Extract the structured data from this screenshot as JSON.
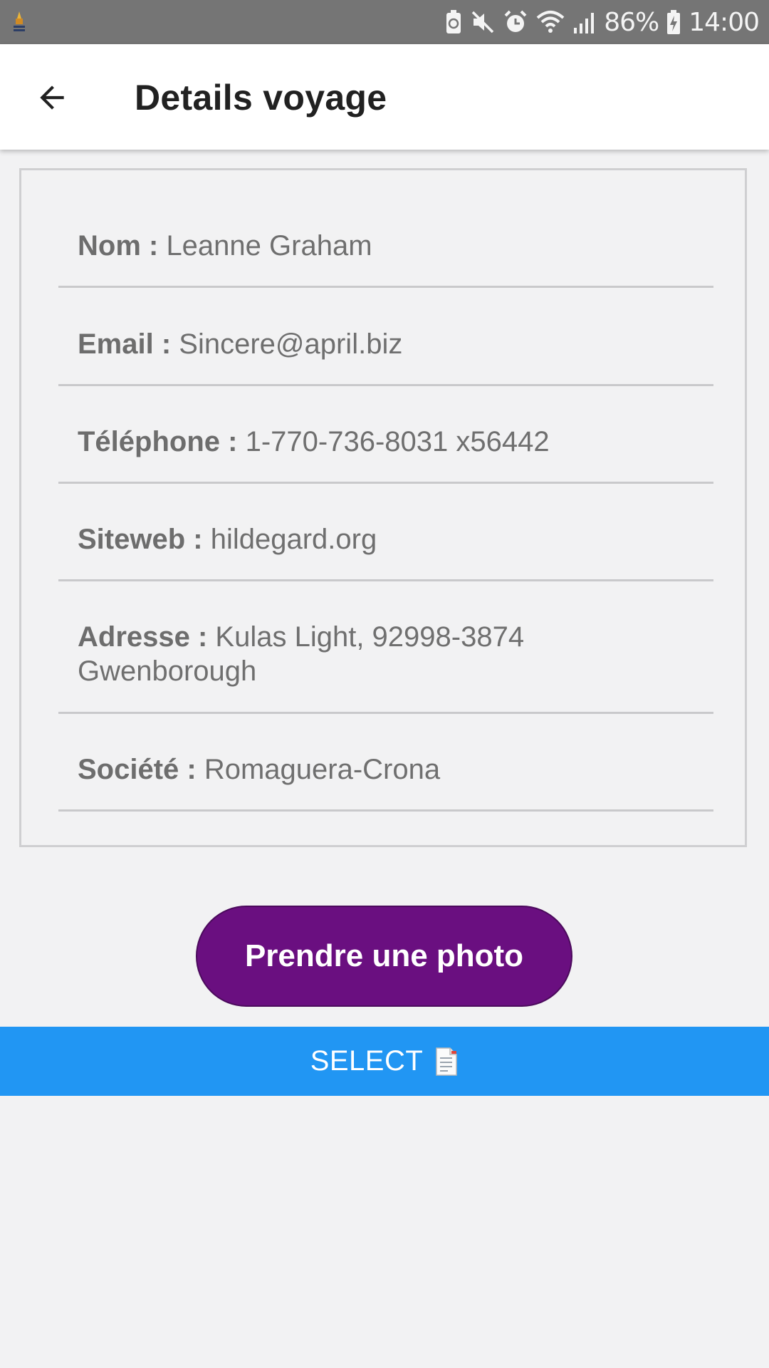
{
  "status_bar": {
    "battery": "86%",
    "time": "14:00",
    "icons": [
      "app-notification-icon",
      "battery-saver-icon",
      "mute-icon",
      "alarm-icon",
      "wifi-icon",
      "signal-icon",
      "battery-charging-icon"
    ]
  },
  "app_bar": {
    "back_icon": "arrow-back-icon",
    "title": "Details voyage"
  },
  "details": {
    "nom": {
      "label": "Nom : ",
      "value": "Leanne Graham"
    },
    "email": {
      "label": "Email : ",
      "value": "Sincere@april.biz"
    },
    "telephone": {
      "label": "Téléphone : ",
      "value": "1-770-736-8031 x56442"
    },
    "siteweb": {
      "label": "Siteweb : ",
      "value": "hildegard.org"
    },
    "adresse": {
      "label": "Adresse : ",
      "value": "Kulas Light, 92998-3874",
      "value_line2": "Gwenborough"
    },
    "societe": {
      "label": "Société : ",
      "value": "Romaguera-Crona"
    }
  },
  "actions": {
    "photo_label": "Prendre une photo",
    "select_label": "SELECT",
    "select_icon": "document-icon"
  },
  "colors": {
    "status_bar": "#757575",
    "app_bar": "#ffffff",
    "background": "#f2f2f3",
    "photo_button": "#6a0f80",
    "select_button": "#2196f3",
    "label_text": "#6d6d6d"
  }
}
